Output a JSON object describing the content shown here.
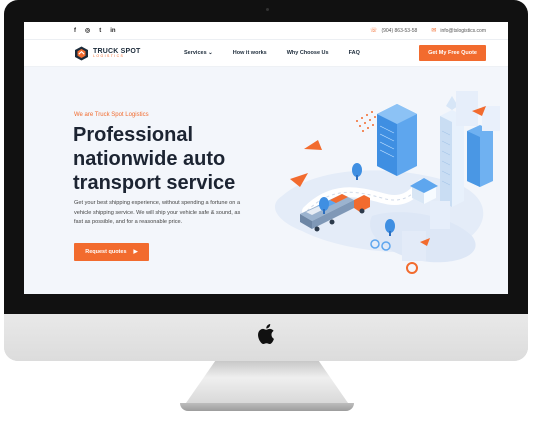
{
  "topbar": {
    "socials": [
      "f",
      "◎",
      "t",
      "in"
    ],
    "phone": "(904) 863-53-58",
    "email": "info@tslogistics.com"
  },
  "nav": {
    "logo_name": "TRUCK SPOT",
    "logo_sub": "LOGISTICS",
    "items": [
      {
        "label": "Services ⌄"
      },
      {
        "label": "How it works"
      },
      {
        "label": "Why Choose Us"
      },
      {
        "label": "FAQ"
      }
    ],
    "cta_label": "Get My Free Quote"
  },
  "hero": {
    "eyebrow": "We are Truck Spot Logistics",
    "headline": "Professional nationwide auto transport service",
    "description": "Get your best shipping experience, without spending a fortune on a vehicle shipping service. We will ship your vehicle safe & sound, as fast as possible, and for a reasonable price.",
    "button_label": "Request quotes",
    "button_icon": "▶"
  },
  "colors": {
    "accent": "#f26b2e",
    "dark": "#1c2432",
    "screen_bg": "#f3f6fb",
    "building": "#5ea6ee"
  }
}
